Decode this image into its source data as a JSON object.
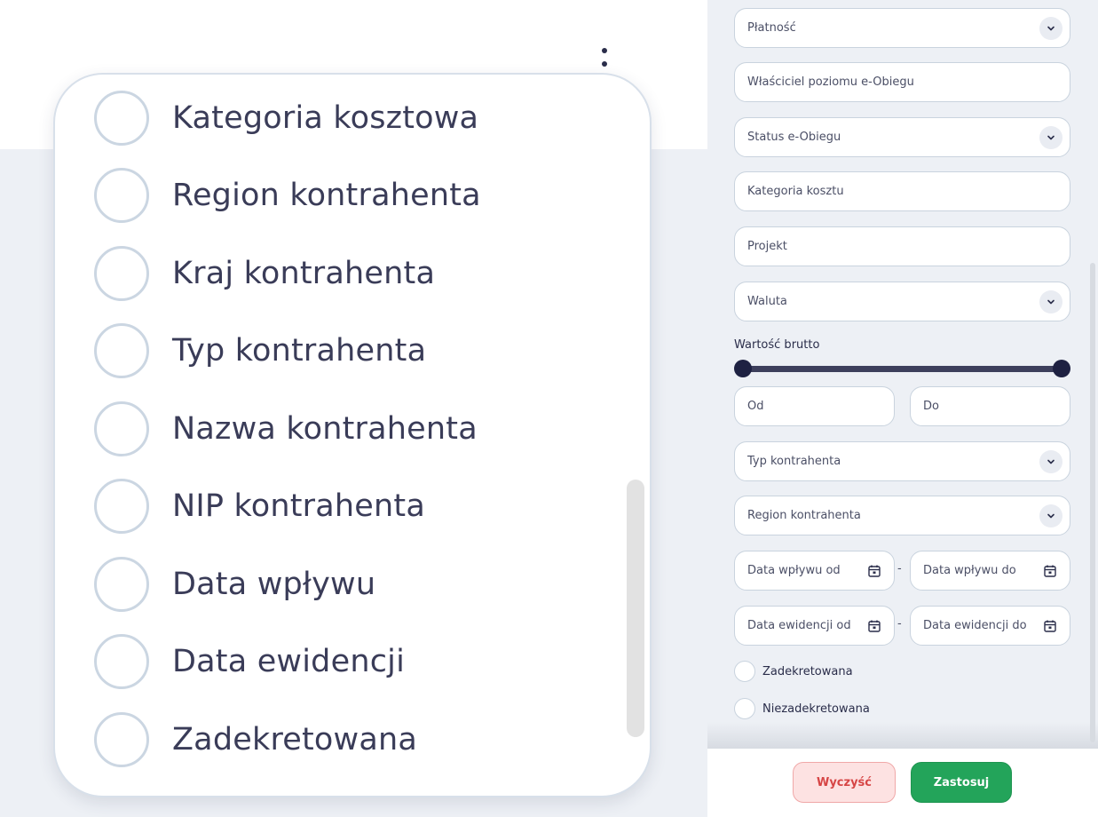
{
  "column_chooser": {
    "items": [
      {
        "label": "Kategoria kosztowa"
      },
      {
        "label": "Region kontrahenta"
      },
      {
        "label": "Kraj kontrahenta"
      },
      {
        "label": "Typ kontrahenta"
      },
      {
        "label": "Nazwa kontrahenta"
      },
      {
        "label": "NIP kontrahenta"
      },
      {
        "label": "Data wpływu"
      },
      {
        "label": "Data ewidencji"
      },
      {
        "label": "Zadekretowana"
      }
    ]
  },
  "filters": {
    "platnosc": "Płatność",
    "wlasciciel": "Właściciel poziomu e-Obiegu",
    "status": "Status e-Obiegu",
    "kategoria": "Kategoria kosztu",
    "projekt": "Projekt",
    "waluta": "Waluta",
    "wartosc_label": "Wartość brutto",
    "od": "Od",
    "do": "Do",
    "typ": "Typ kontrahenta",
    "region": "Region kontrahenta",
    "data_wplywu_od": "Data wpływu od",
    "data_wplywu_do": "Data wpływu do",
    "data_ewidencji_od": "Data ewidencji od",
    "data_ewidencji_do": "Data ewidencji do",
    "range_separator": "-",
    "zadekretowana": "Zadekretowana",
    "niezadekretowana": "Niezadekretowana"
  },
  "footer": {
    "clear_label": "Wyczyść",
    "apply_label": "Zastosuj"
  },
  "colors": {
    "accent_dark": "#1e2142",
    "apply_green": "#23a45a",
    "clear_red": "#d64545"
  }
}
